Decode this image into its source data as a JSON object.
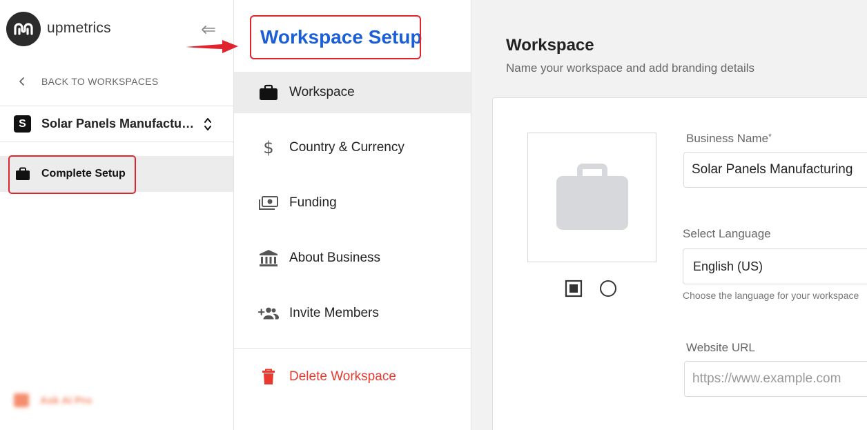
{
  "app": {
    "name": "upmetrics"
  },
  "sidebar": {
    "back_label": "BACK TO WORKSPACES",
    "workspace_badge": "S",
    "workspace_name": "Solar Panels Manufacturing",
    "complete_setup_label": "Complete Setup",
    "blurred_item": "Ask AI Pro"
  },
  "setup_nav": {
    "title": "Workspace Setup",
    "items": [
      {
        "label": "Workspace",
        "icon": "briefcase-icon",
        "active": true
      },
      {
        "label": "Country & Currency",
        "icon": "dollar-icon"
      },
      {
        "label": "Funding",
        "icon": "money-icon"
      },
      {
        "label": "About Business",
        "icon": "bank-icon"
      },
      {
        "label": "Invite Members",
        "icon": "add-people-icon"
      }
    ],
    "delete_label": "Delete Workspace"
  },
  "main": {
    "title": "Workspace",
    "subtitle": "Name your workspace and add branding details",
    "business_name_label": "Business Name",
    "required_mark": "*",
    "business_name_value": "Solar Panels Manufacturing",
    "language_label": "Select Language",
    "language_value": "English (US)",
    "language_help": "Choose the language for your workspace",
    "website_label": "Website URL",
    "website_placeholder": "https://www.example.com"
  },
  "colors": {
    "accent_blue": "#1a5fd8",
    "highlight_red": "#e0232d",
    "danger": "#e8382f",
    "active_bg": "#ececec"
  }
}
